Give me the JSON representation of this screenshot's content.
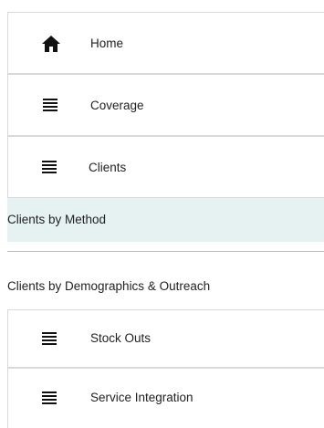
{
  "nav": {
    "home": {
      "label": "Home",
      "icon": "home-icon"
    },
    "coverage": {
      "label": "Coverage",
      "icon": "list-icon"
    },
    "clients": {
      "label": "Clients",
      "icon": "list-icon"
    },
    "clients_sub": [
      {
        "label": "Clients by Method",
        "active": true
      },
      {
        "label": "Clients by Demographics & Outreach",
        "active": false
      }
    ],
    "stock_outs": {
      "label": "Stock Outs",
      "icon": "list-icon"
    },
    "service_integration": {
      "label": "Service Integration",
      "icon": "list-icon"
    }
  },
  "colors": {
    "active_bg": "#e6f2f2",
    "border": "#d9d9d9"
  }
}
